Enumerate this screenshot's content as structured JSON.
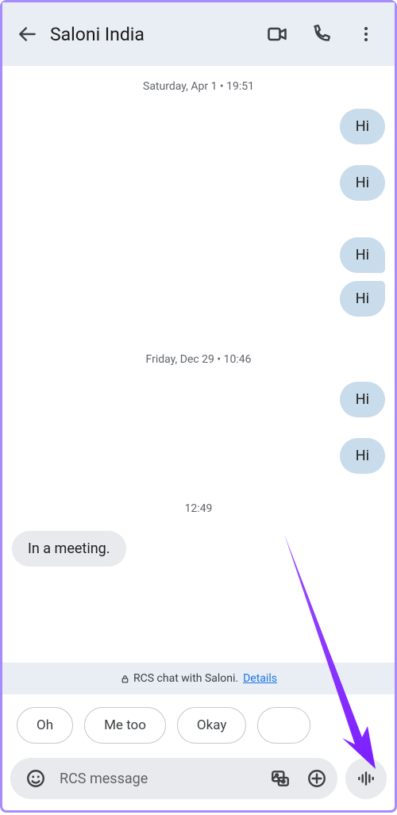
{
  "header": {
    "title": "Saloni India"
  },
  "timeline": {
    "date1": "Saturday, Apr 1 • 19:51",
    "date2": "Friday, Dec 29 • 10:46",
    "time3": "12:49",
    "out": [
      "Hi",
      "Hi",
      "Hi",
      "Hi",
      "Hi",
      "Hi"
    ],
    "in1": "In a meeting."
  },
  "rcs": {
    "text": "RCS chat with Saloni.",
    "details": "Details"
  },
  "suggestions": [
    "Oh",
    "Me too",
    "Okay"
  ],
  "compose": {
    "placeholder": "RCS message"
  }
}
